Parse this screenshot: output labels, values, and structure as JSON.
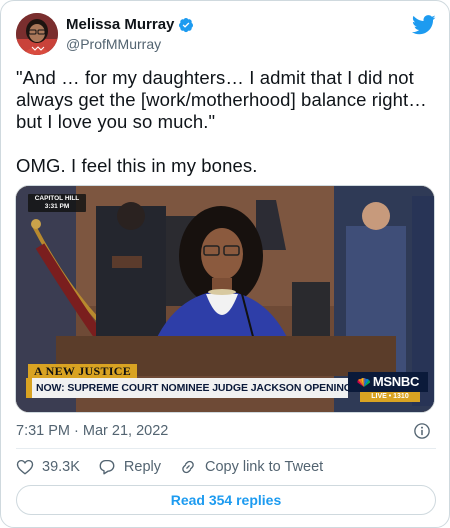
{
  "author": {
    "display_name": "Melissa Murray",
    "handle": "@ProfMMurray",
    "verified": true,
    "icons": {
      "verified": "verified-badge-icon",
      "platform": "twitter-bird-icon"
    }
  },
  "tweet": {
    "paragraphs": [
      "\"And … for my daughters… I admit that I did not always get the [work/motherhood] balance right… but I love you so much.\"",
      "OMG.  I feel this in my bones."
    ]
  },
  "media": {
    "bug_line1": "CAPITOL HILL",
    "bug_line2": "3:31 PM",
    "show_title": "A NEW JUSTICE",
    "chyron": "NOW: SUPREME COURT NOMINEE JUDGE JACKSON OPENING REMARKS",
    "network": "MSNBC",
    "live_tag": "LIVE • 1310"
  },
  "timestamp": "7:31 PM · Mar 21, 2022",
  "actions": {
    "like_count": "39.3K",
    "reply_label": "Reply",
    "copy_label": "Copy link to Tweet"
  },
  "replies_button": "Read 354 replies",
  "colors": {
    "accent": "#1d9bf0",
    "secondary_text": "#536471",
    "border": "#cfd9de",
    "like_red": "#f91880"
  }
}
